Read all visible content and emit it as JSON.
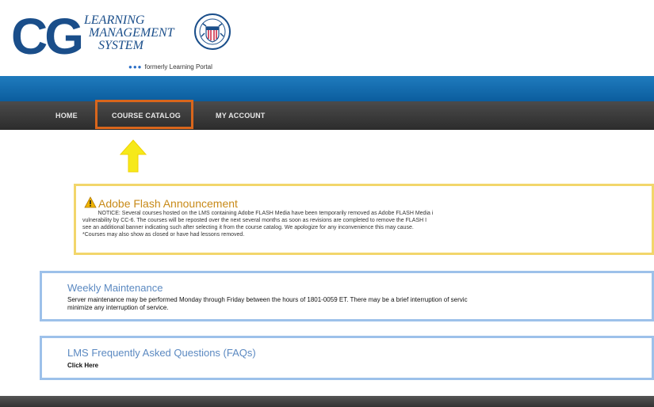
{
  "logo": {
    "initials": "CG",
    "line1": "LEARNING",
    "line2": "MANAGEMENT",
    "line3": "SYSTEM",
    "tagline": "formerly Learning Portal",
    "tagline_dots": "●●●"
  },
  "nav": {
    "items": [
      {
        "label": "HOME"
      },
      {
        "label": "COURSE CATALOG"
      },
      {
        "label": "MY ACCOUNT"
      }
    ],
    "highlight_color": "#d9661c"
  },
  "annotation": {
    "arrow_color": "#f6e91a"
  },
  "flash_announcement": {
    "title": "Adobe Flash Announcement",
    "body": "          NOTICE: Several courses hosted on the LMS containing Adobe FLASH Media have been temporarily removed as Adobe FLASH Media i\nvulnerability by CC-6. The courses will be reposted over the next several months as soon as revisions are completed to remove the FLASH I\nsee an additional banner indicating such after selecting it from the course catalog. We apologize for any inconvenience this may cause.\n*Courses may also show as closed or have had lessons removed.",
    "border_color": "#f2d66b"
  },
  "weekly_maintenance": {
    "title": "Weekly Maintenance",
    "body": "Server maintenance may be performed Monday through Friday between the hours of 1801-0059 ET. There may be a brief interruption of servic\nminimize any interruption of service."
  },
  "faq": {
    "title": "LMS Frequently Asked Questions (FAQs)",
    "link": "Click Here"
  },
  "colors": {
    "brand_blue": "#1a4e8a",
    "blue_bar": "#0b5d9e",
    "nav_bg": "#3a3a3a",
    "box_border": "#9dc1ea"
  }
}
